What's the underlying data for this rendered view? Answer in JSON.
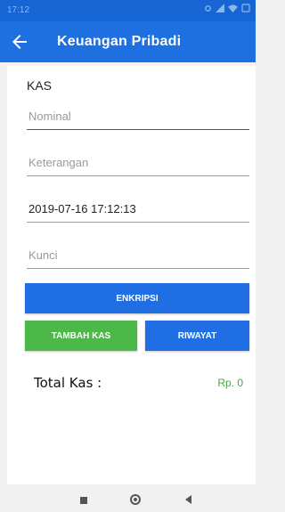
{
  "status_bar": {
    "time": "17:12",
    "icons": [
      "settings-icon",
      "signal-icon",
      "wifi-icon",
      "battery-icon"
    ]
  },
  "app_bar": {
    "title": "Keuangan Pribadi",
    "back_icon": "arrow-left-icon"
  },
  "kas_form": {
    "section_title": "KAS",
    "nominal": {
      "placeholder": "Nominal",
      "value": ""
    },
    "keterangan": {
      "placeholder": "Keterangan",
      "value": ""
    },
    "tanggal": {
      "placeholder": "",
      "value": "2019-07-16 17:12:13"
    },
    "kunci": {
      "placeholder": "Kunci",
      "value": ""
    }
  },
  "buttons": {
    "enkripsi": "ENKRIPSI",
    "tambah_kas": "TAMBAH KAS",
    "riwayat": "RIWAYAT"
  },
  "total": {
    "label": "Total Kas :",
    "value": "Rp. 0"
  },
  "colors": {
    "primary": "#1e6fe0",
    "status_bar": "#1765d3",
    "success": "#4cb84a",
    "total_value": "#44a844"
  },
  "nav_bar": {
    "icons": [
      "recents-square-icon",
      "home-circle-icon",
      "back-triangle-icon"
    ]
  }
}
